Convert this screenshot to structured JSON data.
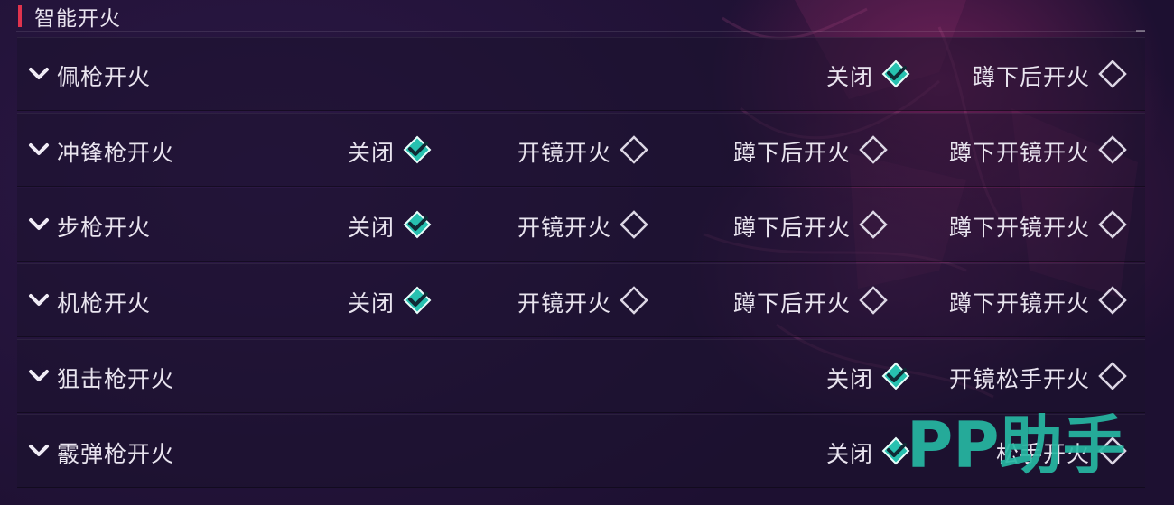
{
  "section": {
    "title": "智能开火"
  },
  "colors": {
    "accent": "#e0334d",
    "checked_fill": "#27c1b0",
    "text": "#e9e4ef",
    "unchecked_stroke": "#dcd6e4"
  },
  "icons": {
    "row_toggle": "chevron-down-icon",
    "option_checked": "checked-diamond-icon",
    "option_unchecked": "diamond-icon"
  },
  "rows": [
    {
      "label": "佩枪开火",
      "options": [
        {
          "label": "关闭",
          "checked": true
        },
        {
          "label": "蹲下后开火",
          "checked": false
        }
      ]
    },
    {
      "label": "冲锋枪开火",
      "options": [
        {
          "label": "关闭",
          "checked": true
        },
        {
          "label": "开镜开火",
          "checked": false
        },
        {
          "label": "蹲下后开火",
          "checked": false
        },
        {
          "label": "蹲下开镜开火",
          "checked": false
        }
      ]
    },
    {
      "label": "步枪开火",
      "options": [
        {
          "label": "关闭",
          "checked": true
        },
        {
          "label": "开镜开火",
          "checked": false
        },
        {
          "label": "蹲下后开火",
          "checked": false
        },
        {
          "label": "蹲下开镜开火",
          "checked": false
        }
      ]
    },
    {
      "label": "机枪开火",
      "options": [
        {
          "label": "关闭",
          "checked": true
        },
        {
          "label": "开镜开火",
          "checked": false
        },
        {
          "label": "蹲下后开火",
          "checked": false
        },
        {
          "label": "蹲下开镜开火",
          "checked": false
        }
      ]
    },
    {
      "label": "狙击枪开火",
      "options": [
        {
          "label": "关闭",
          "checked": true
        },
        {
          "label": "开镜松手开火",
          "checked": false
        }
      ]
    },
    {
      "label": "霰弹枪开火",
      "options": [
        {
          "label": "关闭",
          "checked": true
        },
        {
          "label": "松手开火",
          "checked": false
        }
      ]
    }
  ],
  "watermark": {
    "text": "PP助手"
  }
}
